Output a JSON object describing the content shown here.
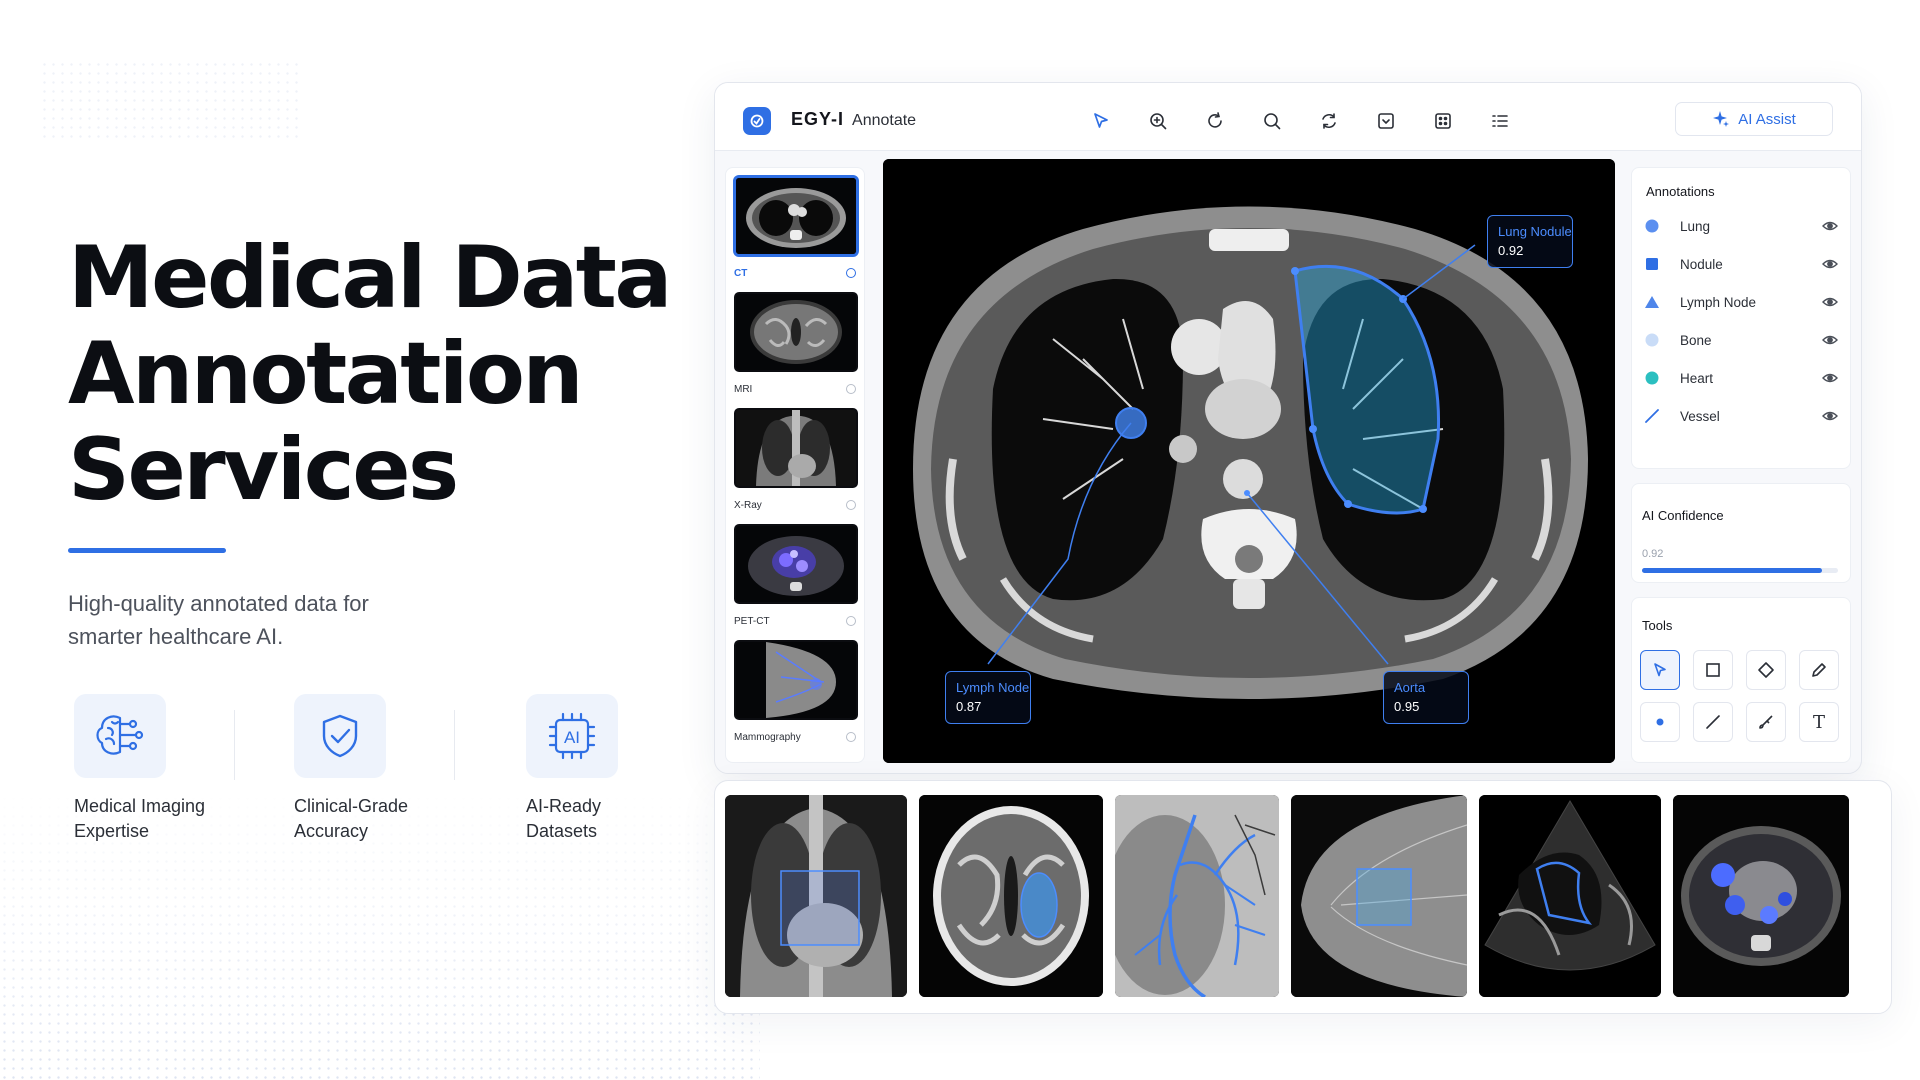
{
  "hero": {
    "title_lines": [
      "Medical Data",
      "Annotation",
      "Services"
    ],
    "subtitle_line1": "High-quality annotated data for",
    "subtitle_line2": "smarter healthcare AI."
  },
  "features": [
    {
      "line1": "Medical Imaging",
      "line2": "Expertise",
      "icon": "brain-circuit-icon"
    },
    {
      "line1": "Clinical-Grade",
      "line2": "Accuracy",
      "icon": "shield-check-icon"
    },
    {
      "line1": "AI-Ready",
      "line2": "Datasets",
      "icon": "ai-chip-icon",
      "chip_text": "AI"
    }
  ],
  "app": {
    "brand_name": "EGY-I",
    "brand_product": "Annotate",
    "ai_assist_label": "AI Assist",
    "toolbar_icons": [
      "pointer-icon",
      "zoom-in-icon",
      "rotate-icon",
      "search-icon",
      "reset-view-icon",
      "dropdown-box-icon",
      "grid-icon",
      "list-icon"
    ],
    "modalities": [
      {
        "label": "CT",
        "active": true
      },
      {
        "label": "MRI",
        "active": false
      },
      {
        "label": "X-Ray",
        "active": false
      },
      {
        "label": "PET-CT",
        "active": false
      },
      {
        "label": "Mammography",
        "active": false
      }
    ],
    "callouts": [
      {
        "name": "Lung Nodule",
        "value": "0.92"
      },
      {
        "name": "Lymph Node",
        "value": "0.87"
      },
      {
        "name": "Aorta",
        "value": "0.95"
      }
    ],
    "annotations_title": "Annotations",
    "annotations": [
      {
        "label": "Lung",
        "shape": "circle",
        "color": "#5b8ff0"
      },
      {
        "label": "Nodule",
        "shape": "square",
        "color": "#2f6fe4"
      },
      {
        "label": "Lymph Node",
        "shape": "triangle",
        "color": "#4f86ea"
      },
      {
        "label": "Bone",
        "shape": "circle",
        "color": "#c9dcf7"
      },
      {
        "label": "Heart",
        "shape": "circle",
        "color": "#2bbfc0"
      },
      {
        "label": "Vessel",
        "shape": "line",
        "color": "#2f6fe4"
      }
    ],
    "confidence_title": "AI Confidence",
    "confidence_value": "0.92",
    "confidence_fraction": 0.92,
    "tools_title": "Tools",
    "tools": [
      "select-tool-icon",
      "rectangle-tool-icon",
      "polygon-tool-icon",
      "pen-tool-icon",
      "point-tool-icon",
      "line-tool-icon",
      "brush-tool-icon",
      "text-tool-icon"
    ],
    "tool_text_glyph": "T"
  },
  "colors": {
    "accent": "#2f6fe4",
    "callout_text": "#4c8dff",
    "heading": "#0c0e13"
  },
  "strip_images": [
    "Chest X-ray with heart region box",
    "Brain MRI with lesion segmentation",
    "Angiogram with vessel tracing",
    "Mammogram with region box",
    "Cardiac ultrasound with chamber outline",
    "PET-CT with highlighted uptake"
  ]
}
